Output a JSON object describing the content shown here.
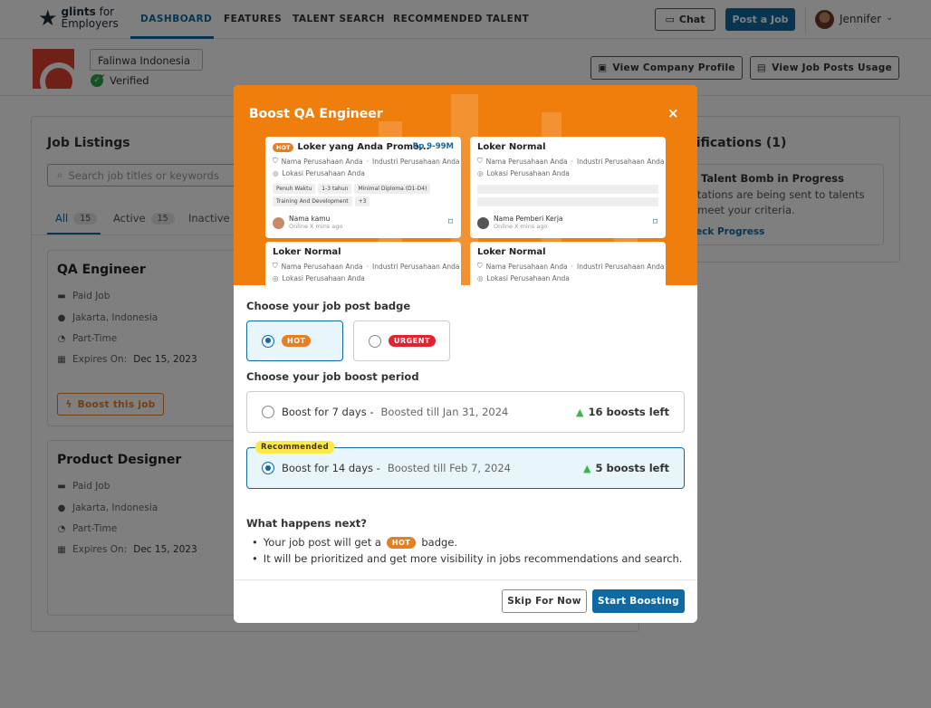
{
  "nav": {
    "logo_brand": "glints",
    "logo_suffix": "for",
    "logo_sub": "Employers",
    "links": [
      "DASHBOARD",
      "FEATURES",
      "TALENT SEARCH",
      "RECOMMENDED TALENT"
    ],
    "chat": "Chat",
    "post_job": "Post a Job",
    "user": "Jennifer"
  },
  "company": {
    "name": "Falinwa Indonesia",
    "verified": "Verified",
    "view_profile": "View Company Profile",
    "view_usage": "View Job Posts Usage"
  },
  "listings": {
    "title": "Job Listings",
    "search_placeholder": "Search job titles or keywords",
    "tabs": [
      {
        "label": "All",
        "count": "15"
      },
      {
        "label": "Active",
        "count": "15"
      },
      {
        "label": "Inactive"
      }
    ],
    "jobs": [
      {
        "title": "QA Engineer",
        "type": "Paid Job",
        "location": "Jakarta, Indonesia",
        "time": "Part-Time",
        "expires_label": "Expires On:",
        "expires": "Dec 15, 2023",
        "boost": "Boost this job"
      },
      {
        "title": "Product Designer",
        "type": "Paid Job",
        "location": "Jakarta, Indonesia",
        "time": "Part-Time",
        "expires_label": "Expires On:",
        "expires": "Dec 15, 2023"
      }
    ]
  },
  "notifications": {
    "title": "tifications (1)",
    "item_title": "Talent Bomb in Progress",
    "item_line1": "ritations are being sent to talents",
    "item_line2": "t meet your criteria.",
    "item_link": "eck Progress"
  },
  "modal": {
    "title": "Boost QA Engineer",
    "close": "×",
    "preview": [
      {
        "title": "Loker yang Anda Promo...",
        "badge": "HOT",
        "salary": "Rp 9-99M",
        "company": "Nama Perusahaan Anda",
        "industry": "Industri Perusahaan Anda",
        "location": "Lokasi Perusahaan Anda",
        "tags": [
          "Penuh Waktu",
          "1-3 tahun",
          "Minimal Diploma (D1-D4)",
          "Training And Development",
          "+3"
        ],
        "poster": "Nama kamu",
        "online": "Online X mins ago"
      },
      {
        "title": "Loker Normal",
        "company": "Nama Perusahaan Anda",
        "industry": "Industri Perusahaan Anda",
        "location": "Lokasi Perusahaan Anda",
        "poster": "Nama Pemberi Kerja",
        "online": "Online X mins ago"
      },
      {
        "title": "Loker Normal",
        "company": "Nama Perusahaan Anda",
        "industry": "Industri Perusahaan Anda",
        "location": "Lokasi Perusahaan Anda"
      },
      {
        "title": "Loker Normal",
        "company": "Nama Perusahaan Anda",
        "industry": "Industri Perusahaan Anda",
        "location": "Lokasi Perusahaan Anda"
      }
    ],
    "badge_section": "Choose your job post badge",
    "badges": [
      {
        "label": "HOT",
        "color": "#e67e22"
      },
      {
        "label": "URGENT",
        "color": "#e0242f"
      }
    ],
    "period_section": "Choose your job boost period",
    "periods": [
      {
        "label": "Boost for 7 days -",
        "till": "Boosted till Jan 31, 2024",
        "left": "16 boosts left"
      },
      {
        "label": "Boost for 14 days -",
        "till": "Boosted till Feb 7, 2024",
        "left": "5 boosts left",
        "recommended": "Recommended"
      }
    ],
    "next_title": "What happens next?",
    "next_1a": "Your job post will get a",
    "next_1_badge": "HOT",
    "next_1b": "badge.",
    "next_2": "It will be prioritized and get more visibility in jobs recommendations and search.",
    "skip": "Skip For Now",
    "start": "Start Boosting"
  }
}
